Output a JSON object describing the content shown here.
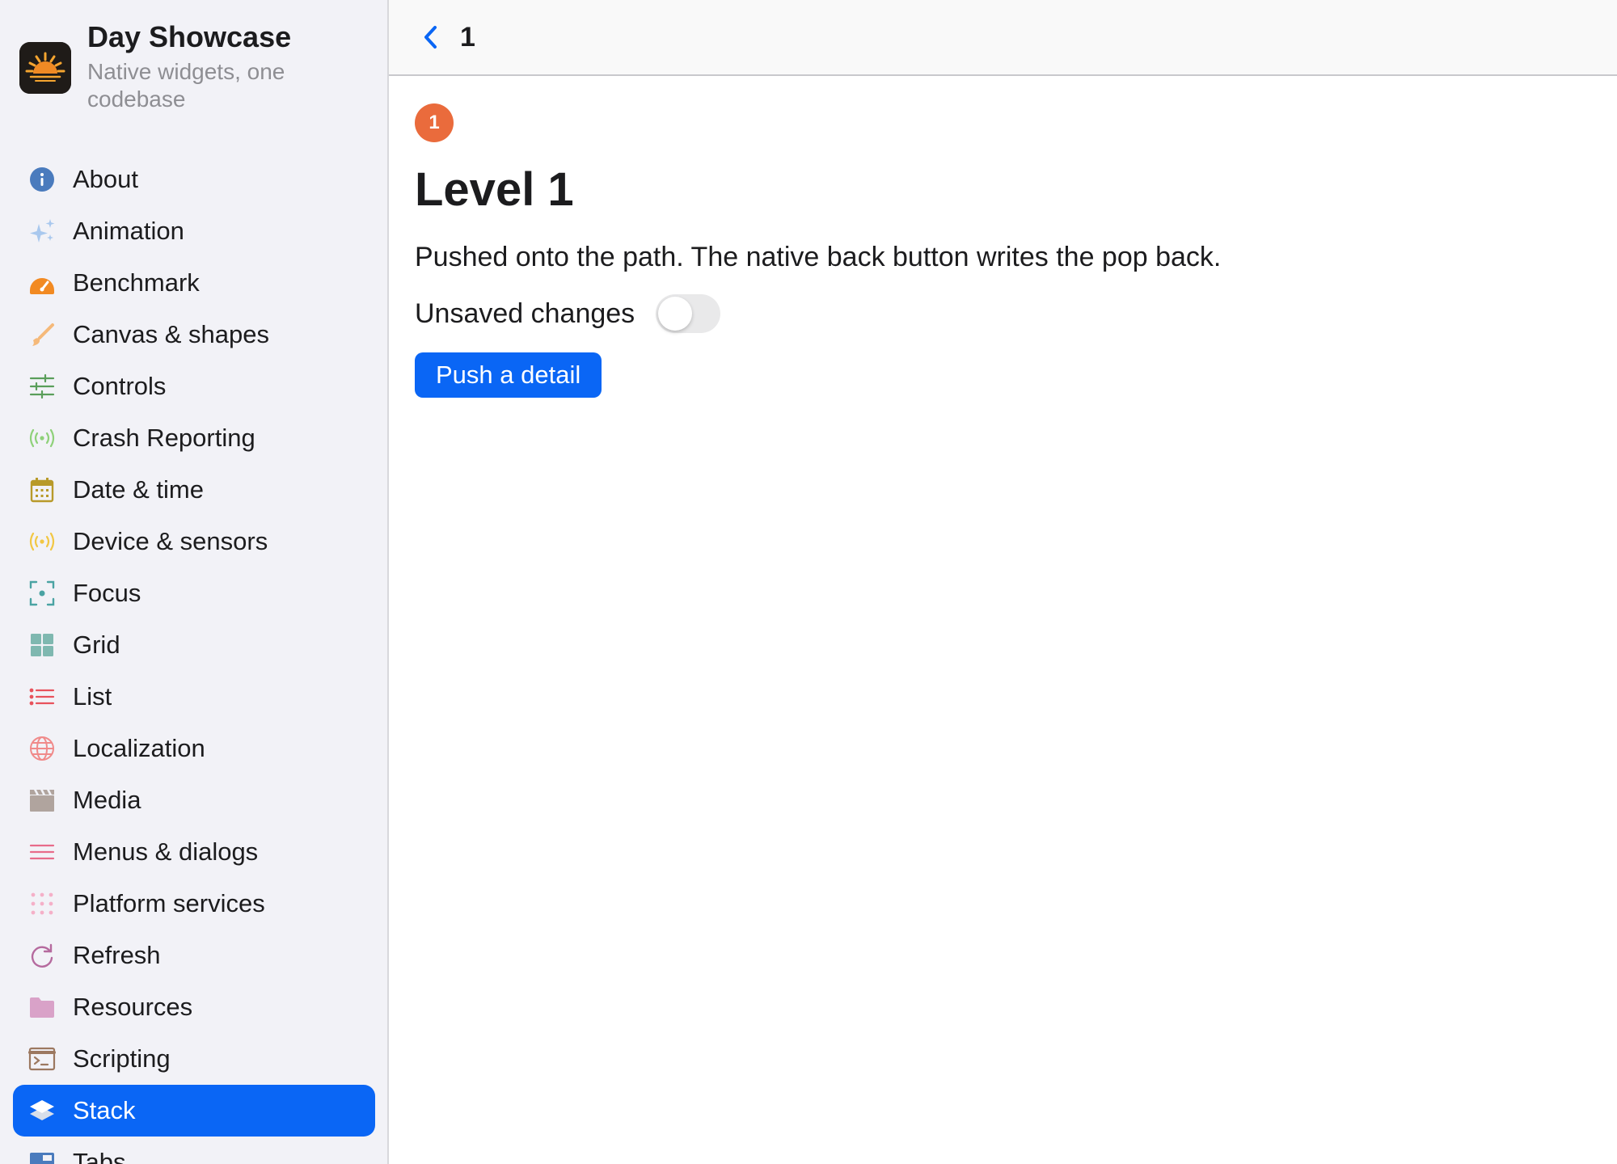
{
  "app": {
    "name": "Day Showcase",
    "subtitle": "Native widgets, one codebase"
  },
  "sidebar": {
    "items": [
      {
        "label": "About",
        "icon": "info-icon"
      },
      {
        "label": "Animation",
        "icon": "sparkles-icon"
      },
      {
        "label": "Benchmark",
        "icon": "gauge-icon"
      },
      {
        "label": "Canvas & shapes",
        "icon": "paintbrush-icon"
      },
      {
        "label": "Controls",
        "icon": "sliders-icon"
      },
      {
        "label": "Crash Reporting",
        "icon": "broadcast-icon"
      },
      {
        "label": "Date & time",
        "icon": "calendar-icon"
      },
      {
        "label": "Device & sensors",
        "icon": "sensor-icon"
      },
      {
        "label": "Focus",
        "icon": "focus-icon"
      },
      {
        "label": "Grid",
        "icon": "grid-icon"
      },
      {
        "label": "List",
        "icon": "list-icon"
      },
      {
        "label": "Localization",
        "icon": "globe-icon"
      },
      {
        "label": "Media",
        "icon": "film-icon"
      },
      {
        "label": "Menus & dialogs",
        "icon": "menu-lines-icon"
      },
      {
        "label": "Platform services",
        "icon": "dots-grid-icon"
      },
      {
        "label": "Refresh",
        "icon": "refresh-icon"
      },
      {
        "label": "Resources",
        "icon": "folder-icon"
      },
      {
        "label": "Scripting",
        "icon": "terminal-icon"
      },
      {
        "label": "Stack",
        "icon": "layers-icon",
        "active": true
      },
      {
        "label": "Tabs",
        "icon": "tabs-icon"
      }
    ]
  },
  "toolbar": {
    "title": "1",
    "back_icon": "chevron-left-icon"
  },
  "content": {
    "badge": "1",
    "title": "Level 1",
    "description": "Pushed onto the path. The native back button writes the pop back.",
    "toggle_label": "Unsaved changes",
    "toggle_on": false,
    "push_button_label": "Push a detail"
  },
  "colors": {
    "accent": "#0a66f5",
    "badge": "#ea6b3c",
    "sidebar_bg": "#f2f2f7"
  }
}
